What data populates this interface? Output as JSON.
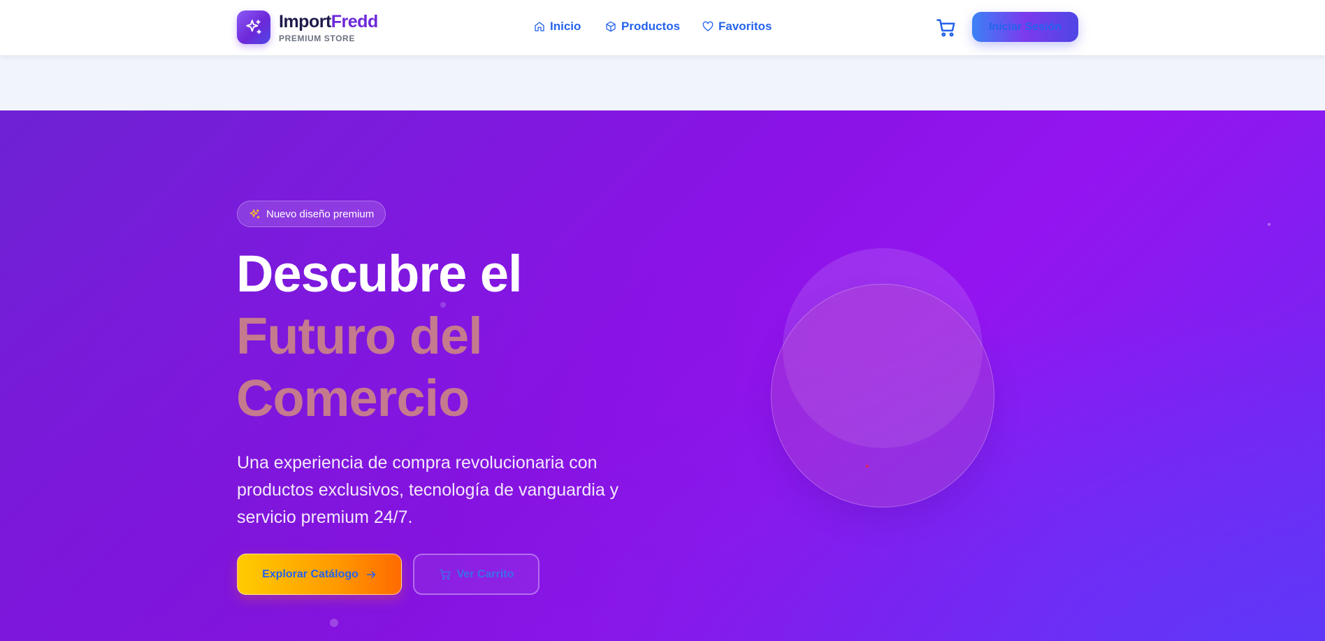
{
  "header": {
    "brand_part1": "Import",
    "brand_part2": "Fredd",
    "brand_subtitle": "PREMIUM STORE",
    "logo_icon": "sparkles-icon",
    "nav": [
      {
        "label": "Inicio",
        "icon": "home-icon"
      },
      {
        "label": "Productos",
        "icon": "box-icon"
      },
      {
        "label": "Favoritos",
        "icon": "heart-icon"
      }
    ],
    "cart_icon": "cart-icon",
    "login_label": "Iniciar Sesión"
  },
  "hero": {
    "badge_label": "Nuevo diseño premium",
    "title_line1": "Descubre el",
    "title_line2": "Futuro del",
    "title_line3": "Comercio",
    "description": "Una experiencia de compra revolucionaria con productos exclusivos, tecnología de vanguardia y servicio premium 24/7.",
    "primary_button": "Explorar Catálogo",
    "secondary_button": "Ver Carrito"
  },
  "colors": {
    "accent": "#2563eb",
    "brand_purple": "#6d28d9",
    "hero_start": "#6d22d3",
    "hero_end": "#6a2cf2",
    "title_highlight": "#c57a8e",
    "primary_button_start": "#ffcc00",
    "primary_button_end": "#ff6a00"
  }
}
